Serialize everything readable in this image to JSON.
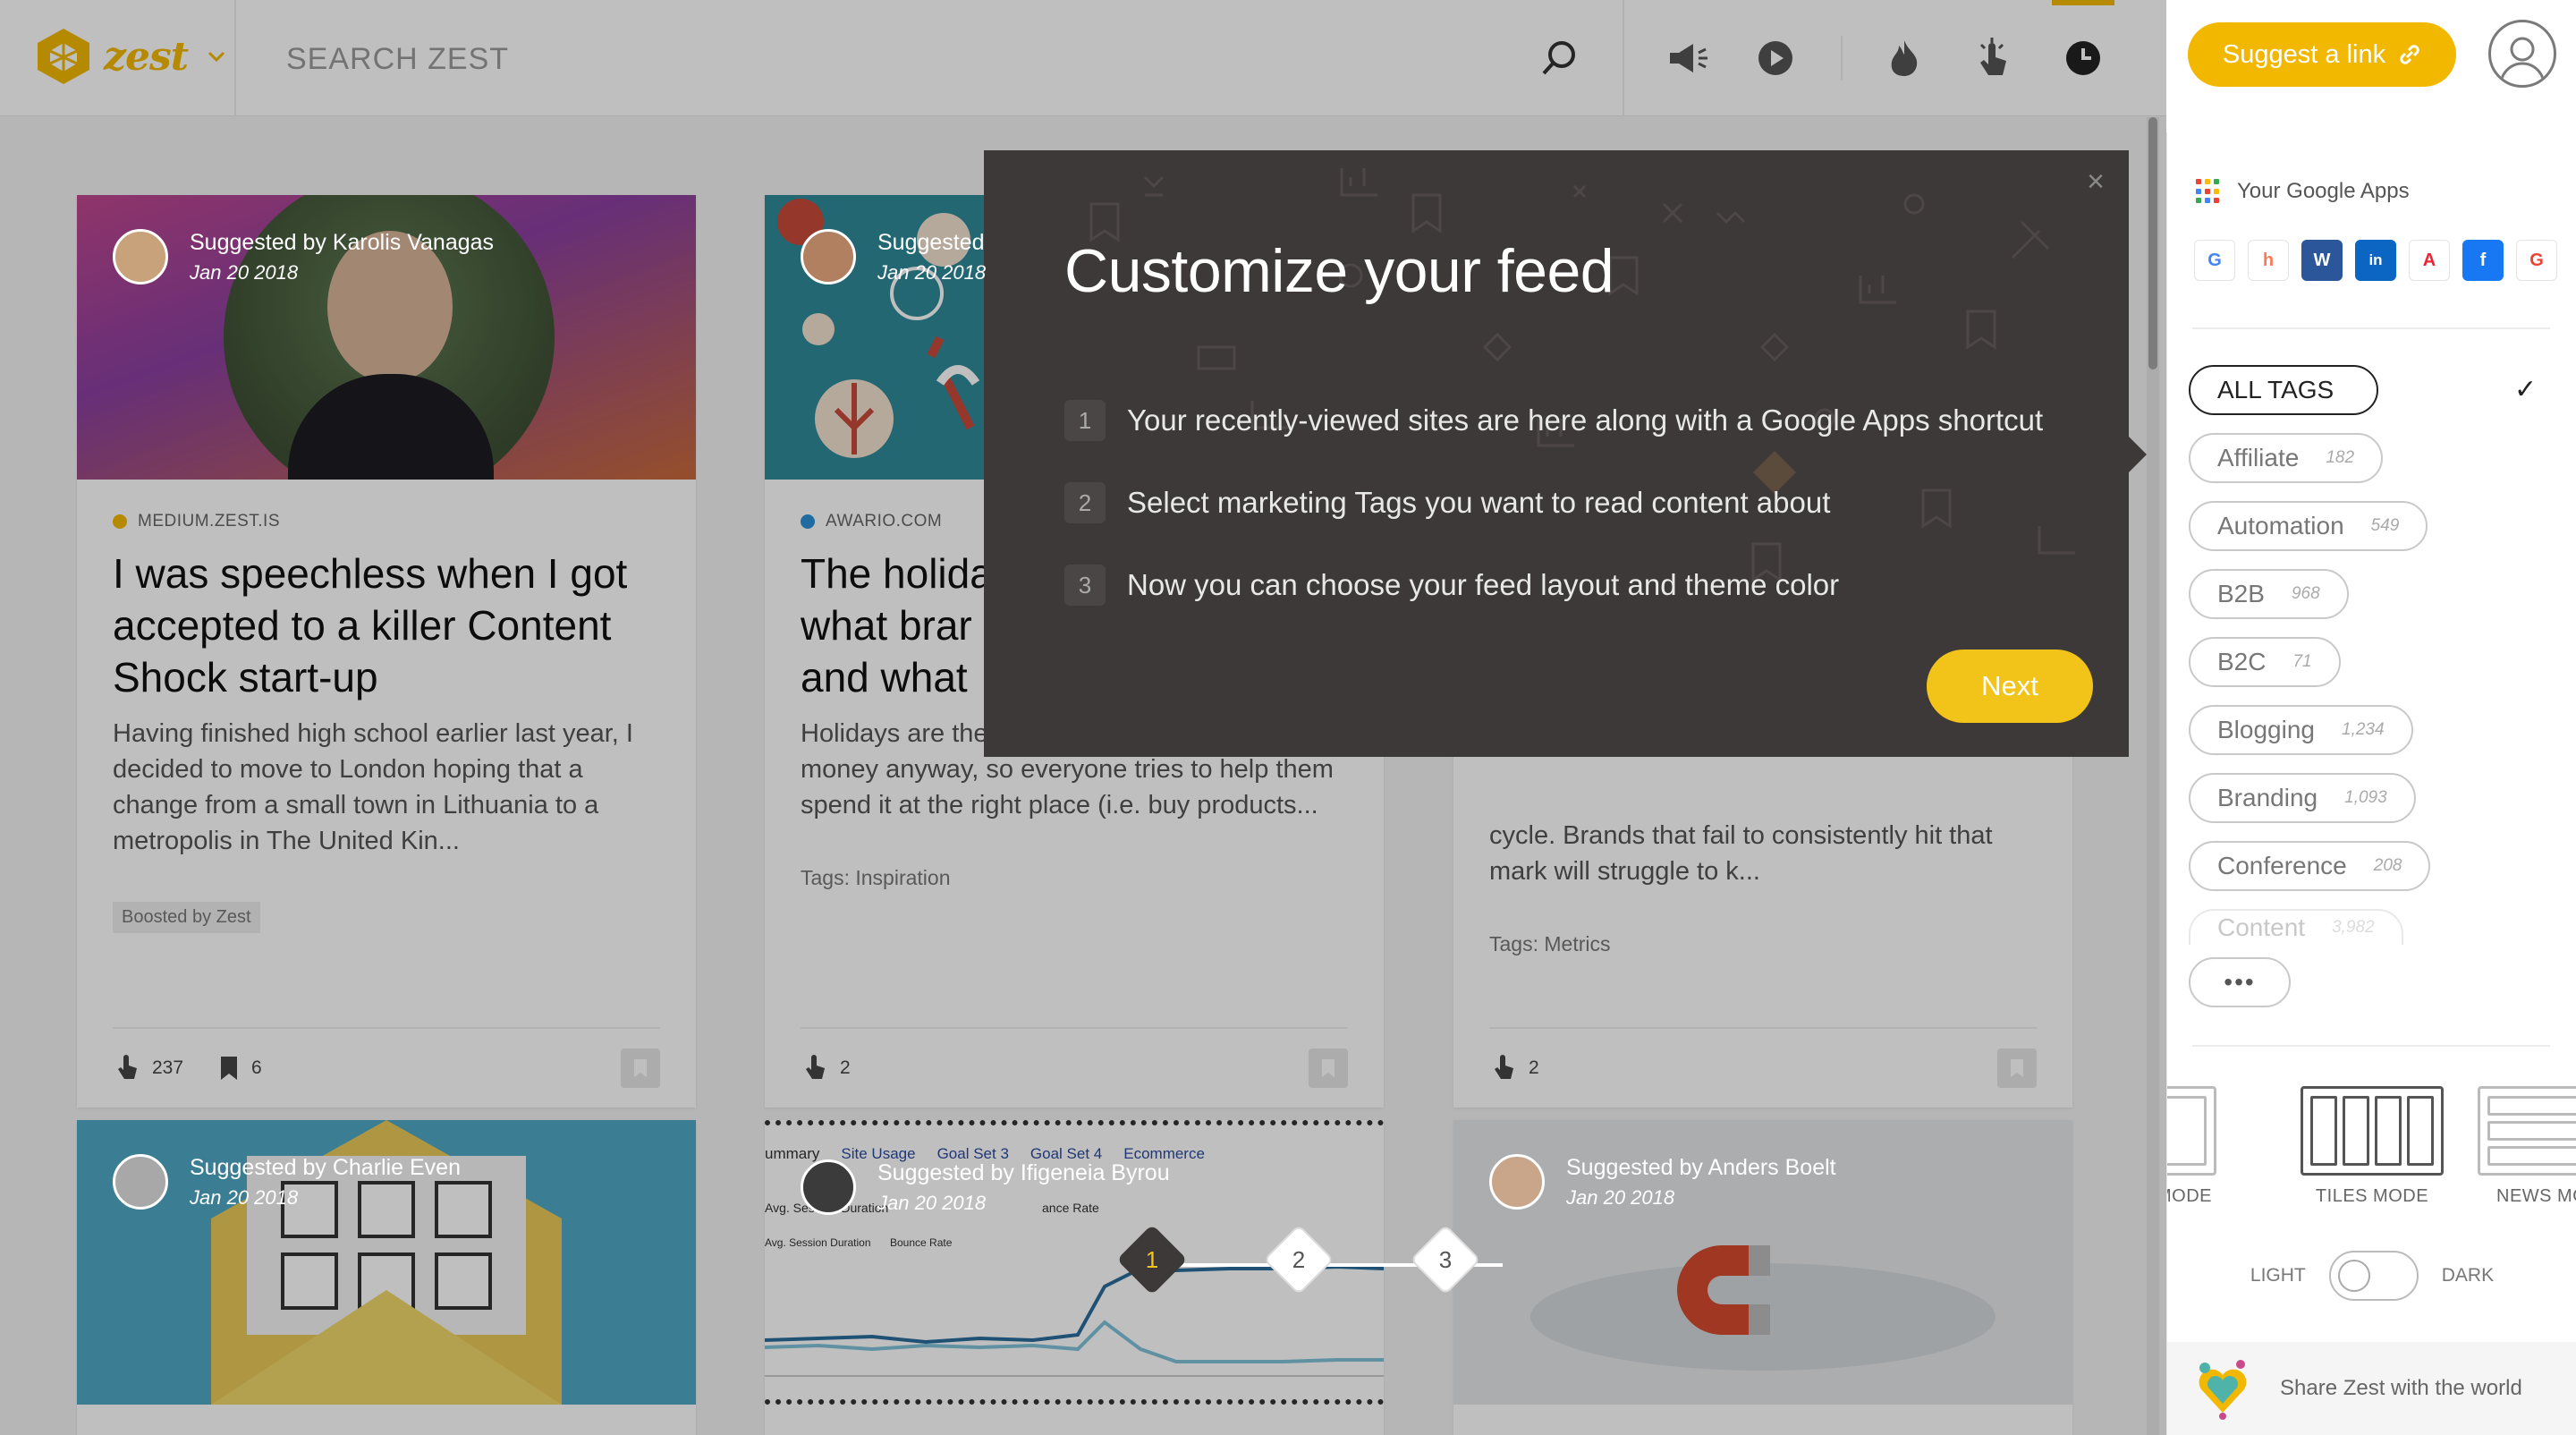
{
  "app": {
    "name": "zest"
  },
  "header": {
    "search_placeholder": "SEARCH ZEST",
    "suggest_label": "Suggest a link",
    "icons": [
      "search-icon",
      "megaphone-icon",
      "play-icon",
      "fire-icon",
      "click-icon",
      "clock-icon"
    ]
  },
  "panel": {
    "google_apps_label": "Your Google Apps",
    "shortcuts": [
      {
        "letter": "G",
        "color": "#4285f4"
      },
      {
        "letter": "h",
        "color": "#ff7a59"
      },
      {
        "letter": "W",
        "color": "#2b579a"
      },
      {
        "letter": "in",
        "color": "#0a66c2"
      },
      {
        "letter": "A",
        "color": "#e23"
      },
      {
        "letter": "f",
        "color": "#1877f2"
      },
      {
        "letter": "G",
        "color": "#ea4335"
      }
    ],
    "tags": [
      {
        "name": "ALL TAGS",
        "count": ""
      },
      {
        "name": "Affiliate",
        "count": "182"
      },
      {
        "name": "Automation",
        "count": "549"
      },
      {
        "name": "B2B",
        "count": "968"
      },
      {
        "name": "B2C",
        "count": "71"
      },
      {
        "name": "Blogging",
        "count": "1,234"
      },
      {
        "name": "Branding",
        "count": "1,093"
      },
      {
        "name": "Conference",
        "count": "208"
      },
      {
        "name": "Content",
        "count": "3,982"
      }
    ],
    "more_label": "•••",
    "modes": [
      {
        "label": "LORE MODE"
      },
      {
        "label": "TILES MODE"
      },
      {
        "label": "NEWS MODE"
      }
    ],
    "theme": {
      "light": "LIGHT",
      "dark": "DARK"
    },
    "share_label": "Share Zest with the world"
  },
  "cards": [
    {
      "suggested_by": "Suggested by Karolis Vanagas",
      "date": "Jan 20 2018",
      "source": "MEDIUM.ZEST.IS",
      "title": "I was speechless when I got accepted to a killer Content Shock start-up",
      "excerpt": "Having finished high school earlier last year, I decided to move to London hoping that a change from a small town in Lithuania to a metropolis in The United Kin...",
      "boost": "Boosted by Zest",
      "clicks": "237",
      "saves": "6"
    },
    {
      "suggested_by": "Suggested",
      "date": "Jan 20 2018",
      "source": "AWARIO.COM",
      "title": "The holida what brar and what",
      "excerpt": "Holidays are the People will spend lots of money anyway, so everyone tries to help them spend it at the right place (i.e. buy products...",
      "tags_label": "Tags:",
      "tag": "Inspiration",
      "clicks": "2"
    },
    {
      "excerpt": "cycle. Brands that fail to consistently hit that mark will struggle to k...",
      "tags_label": "Tags:",
      "tag": "Metrics",
      "clicks": "2"
    },
    {
      "suggested_by": "Suggested by Charlie Even",
      "date": "Jan 20 2018"
    },
    {
      "suggested_by": "Suggested by Ifigeneia Byrou",
      "date": "Jan 20 2018",
      "tabs": [
        "ummary",
        "Site Usage",
        "Goal Set 3",
        "Goal Set 4",
        "Ecommerce"
      ],
      "metrics": [
        "Avg. Session Duration",
        "Bounce Rate"
      ],
      "overlap_label": "ance Rate"
    },
    {
      "suggested_by": "Suggested by Anders Boelt",
      "date": "Jan 20 2018"
    }
  ],
  "modal": {
    "title": "Customize your feed",
    "steps": [
      {
        "num": "1",
        "text": "Your recently-viewed sites are here along with a Google Apps shortcut"
      },
      {
        "num": "2",
        "text": "Select marketing Tags you want to read content about"
      },
      {
        "num": "3",
        "text": "Now you can choose your feed layout and theme color"
      }
    ],
    "next_label": "Next",
    "close": "×"
  },
  "progress": [
    "1",
    "2",
    "3"
  ],
  "colors": {
    "brand": "#f2b800",
    "modal_bg": "#3e3939",
    "next": "#f2c318"
  }
}
